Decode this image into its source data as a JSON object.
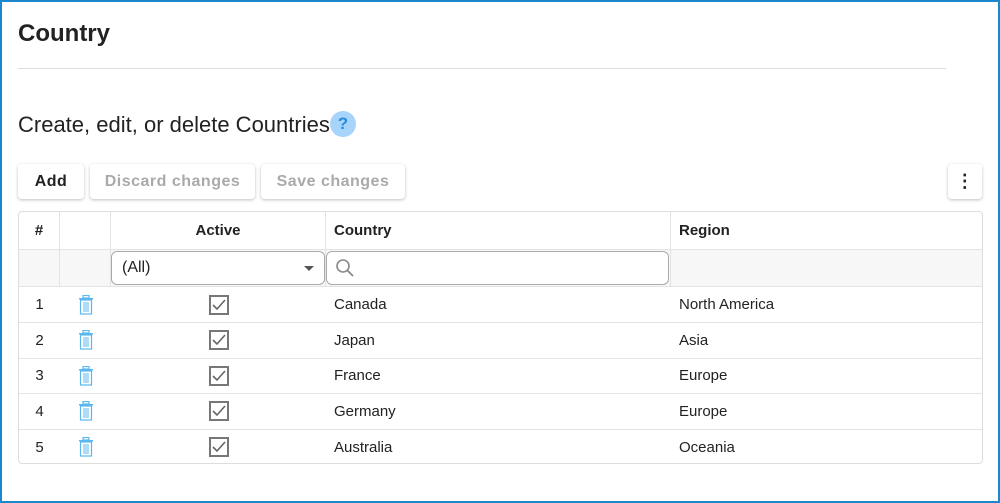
{
  "page": {
    "title": "Country",
    "subtitle": "Create, edit, or delete Countries",
    "help": "?"
  },
  "toolbar": {
    "add": "Add",
    "discard": "Discard changes",
    "save": "Save changes",
    "more": "⋮"
  },
  "grid": {
    "headers": [
      "#",
      "",
      "Active",
      "Country",
      "Region"
    ],
    "filter": {
      "active_value": "(All)",
      "search_placeholder": ""
    },
    "rows": [
      {
        "n": "1",
        "active": true,
        "country": "Canada",
        "region": "North America"
      },
      {
        "n": "2",
        "active": true,
        "country": "Japan",
        "region": "Asia"
      },
      {
        "n": "3",
        "active": true,
        "country": "France",
        "region": "Europe"
      },
      {
        "n": "4",
        "active": true,
        "country": "Germany",
        "region": "Europe"
      },
      {
        "n": "5",
        "active": true,
        "country": "Australia",
        "region": "Oceania"
      }
    ]
  }
}
